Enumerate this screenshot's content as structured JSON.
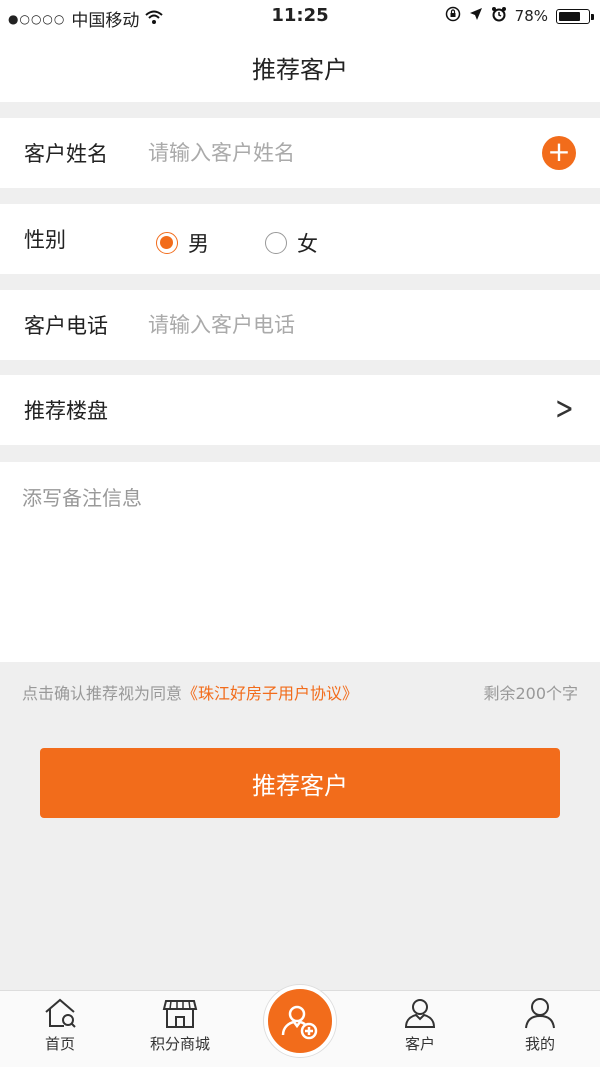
{
  "status": {
    "signal_dots": "●○○○○",
    "carrier": "中国移动",
    "time": "11:25",
    "battery": "78%",
    "battery_level": 0.78
  },
  "nav": {
    "title": "推荐客户"
  },
  "form": {
    "name_label": "客户姓名",
    "name_placeholder": "请输入客户姓名",
    "gender_label": "性别",
    "gender_male": "男",
    "gender_female": "女",
    "phone_label": "客户电话",
    "phone_placeholder": "请输入客户电话",
    "property_label": "推荐楼盘",
    "remarks_placeholder": "添写备注信息"
  },
  "agreement": {
    "prefix": "点击确认推荐视为同意",
    "link": "《珠江好房子用户协议》",
    "counter": "剩余200个字"
  },
  "submit_label": "推荐客户",
  "tabs": {
    "home": "首页",
    "mall": "积分商城",
    "customers": "客户",
    "mine": "我的"
  },
  "colors": {
    "accent": "#f26c1b"
  }
}
